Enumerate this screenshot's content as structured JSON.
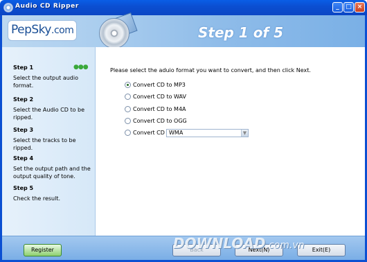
{
  "window": {
    "title": "Audio CD Ripper",
    "controls": {
      "minimize": "_",
      "maximize": "□",
      "close": "×"
    }
  },
  "banner": {
    "logo": "PepSky",
    "logo_suffix": ".com",
    "step_title": "Step 1 of 5"
  },
  "sidebar": {
    "progress_dots": "●●●",
    "steps": [
      {
        "label": "Step 1",
        "desc": "Select the output audio format."
      },
      {
        "label": "Step 2",
        "desc": "Select the Audio CD to be ripped."
      },
      {
        "label": "Step 3",
        "desc": "Select the tracks to be ripped."
      },
      {
        "label": "Step 4",
        "desc": "Set the output path and the output quality of tone."
      },
      {
        "label": "Step 5",
        "desc": "Check the result."
      }
    ]
  },
  "main": {
    "instruction": "Please select the aduio format you want to convert, and then click Next.",
    "options": [
      {
        "label": "Convert CD to MP3",
        "checked": true
      },
      {
        "label": "Convert CD to WAV",
        "checked": false
      },
      {
        "label": "Convert CD to M4A",
        "checked": false
      },
      {
        "label": "Convert CD to OGG",
        "checked": false
      },
      {
        "label": "Convert CD to",
        "checked": false
      }
    ],
    "format_select": {
      "value": "WMA"
    }
  },
  "footer": {
    "register": "Register",
    "back": "Back",
    "next": "Next(N)",
    "exit": "Exit(E)"
  },
  "watermark": {
    "text": "DOWNLOAD",
    "suffix": ".com.vn"
  }
}
